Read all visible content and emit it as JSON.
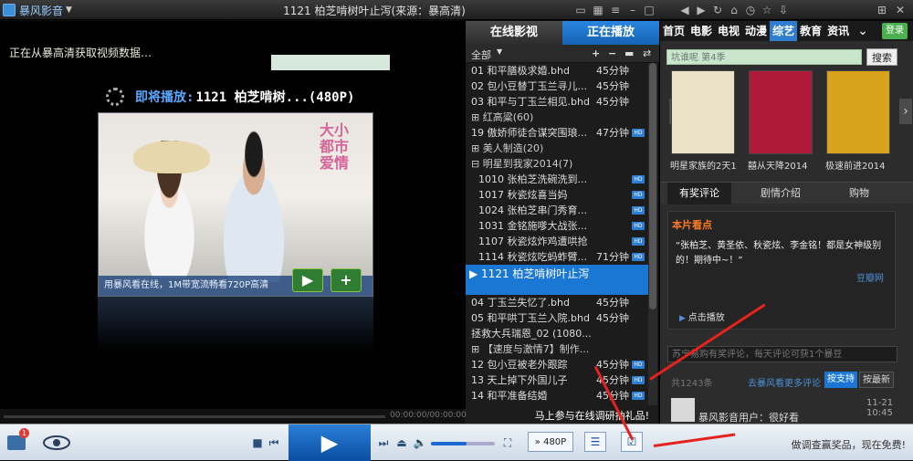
{
  "app": {
    "name": "暴风影音",
    "title": "1121 柏芝啃树叶止泻(来源：暴高清)"
  },
  "video": {
    "status": "正在从暴高清获取视频数据…",
    "next_label": "即将播放:",
    "next_title": "1121 柏芝啃树...(480P)",
    "caption": "用暴风看在线，1M带宽流畅看720P高清",
    "thumb_logo": "大小 都市 爱情"
  },
  "playlist": {
    "tab_online": "在线影视",
    "tab_playing": "正在播放",
    "filter": "全部",
    "rows": [
      {
        "title": "01 和平膳极求婚.bhd",
        "dur": "45分钟",
        "type": "item"
      },
      {
        "title": "02 包小豆替丁玉兰寻儿...",
        "dur": "45分钟",
        "type": "item"
      },
      {
        "title": "03 和平与丁玉兰相见.bhd",
        "dur": "45分钟",
        "type": "item"
      },
      {
        "title": "⊞ 红高粱(60)",
        "dur": "",
        "type": "group"
      },
      {
        "title": "19 傲娇师徒合谋突围琅...",
        "dur": "47分钟",
        "type": "item",
        "hd": true
      },
      {
        "title": "⊞ 美人制造(20)",
        "dur": "",
        "type": "group"
      },
      {
        "title": "⊟ 明星到我家2014(7)",
        "dur": "",
        "type": "group"
      },
      {
        "title": "1010 张柏芝洗碗洗到...",
        "dur": "",
        "type": "sub",
        "hd": true
      },
      {
        "title": "1017 秋瓷炫喜当妈",
        "dur": "",
        "type": "sub",
        "hd": true
      },
      {
        "title": "1024 张柏芝串门秀育...",
        "dur": "",
        "type": "sub",
        "hd": true
      },
      {
        "title": "1031 金铭施嗲大战张...",
        "dur": "",
        "type": "sub",
        "hd": true
      },
      {
        "title": "1107 秋瓷炫炸鸡遭哄抢",
        "dur": "",
        "type": "sub",
        "hd": true
      },
      {
        "title": "1114 秋瓷炫吃蚂蚱臂...",
        "dur": "71分钟",
        "type": "sub",
        "hd": true
      },
      {
        "title": "▶ 1121 柏芝啃树叶止泻",
        "dur": "",
        "type": "active"
      },
      {
        "title": "04 丁玉兰失忆了.bhd",
        "dur": "45分钟",
        "type": "item"
      },
      {
        "title": "05 和平哄丁玉兰入院.bhd",
        "dur": "45分钟",
        "type": "item"
      },
      {
        "title": "拯救大兵瑞恩_02 (1080...",
        "dur": "",
        "type": "item"
      },
      {
        "title": "⊞ 【速度与激情7】制作...",
        "dur": "",
        "type": "group"
      },
      {
        "title": "12 包小豆被老外跟踪",
        "dur": "45分钟",
        "type": "item",
        "hd": true
      },
      {
        "title": "13 天上掉下外国儿子",
        "dur": "45分钟",
        "type": "item",
        "hd": true
      },
      {
        "title": "14 和平准备结婚",
        "dur": "45分钟",
        "type": "item",
        "hd": true
      }
    ],
    "promo": "马上参与在线调研抽礼品!"
  },
  "right": {
    "nav": [
      "首页",
      "电影",
      "电视",
      "动漫",
      "综艺",
      "教育",
      "资讯"
    ],
    "active_nav": "综艺",
    "login": "登录",
    "search_placeholder": "坑谁呢 第4季",
    "search_btn": "搜索",
    "posters": [
      {
        "caption": "明星家族的2天1",
        "color": "#e9e2c6"
      },
      {
        "caption": "囍从天降2014",
        "color": "#b01a3a"
      },
      {
        "caption": "极速前进2014",
        "color": "#d8a21a"
      }
    ],
    "tabs": [
      "有奖评论",
      "剧情介绍",
      "购物"
    ],
    "section_title": "本片看点",
    "section_body": "“张柏芝、黄圣依、秋瓷炫、李金铭！都是女神级别的！期待中~！”",
    "section_link": "豆瓣网",
    "play_link": "点击播放",
    "comment_placeholder": "苏宁易购有奖评论，每天评论可获1个暴豆",
    "comment_count": "共1243条",
    "comment_right": "去暴风看更多评论",
    "support_btn": "按支持",
    "newest_btn": "按最新",
    "comment_time": "11-21 10:45",
    "comment_user": "暴风影音用户：很好看"
  },
  "controls": {
    "time": "00:00:00/00:00:00",
    "quality": "480P",
    "volume": 0.55,
    "badge": "1",
    "bottom_promo": "做调查赢奖品，现在免费!"
  }
}
